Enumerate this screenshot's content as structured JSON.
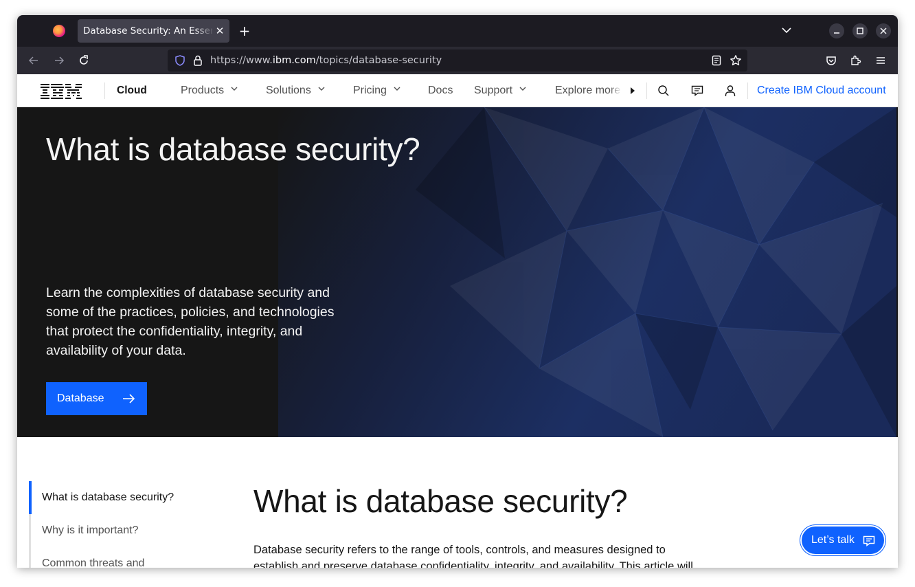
{
  "browser": {
    "tab_title": "Database Security: An Essential Guide",
    "url_prefix": "https://www.",
    "url_host": "ibm.com",
    "url_path": "/topics/database-security",
    "new_tab_symbol": "+",
    "close_tab_symbol": "✕"
  },
  "masthead": {
    "logo": "IBM",
    "product": "Cloud",
    "nav": [
      {
        "label": "Products",
        "has_menu": true
      },
      {
        "label": "Solutions",
        "has_menu": true
      },
      {
        "label": "Pricing",
        "has_menu": true
      },
      {
        "label": "Docs",
        "has_menu": false
      },
      {
        "label": "Support",
        "has_menu": true
      },
      {
        "label": "Explore more",
        "has_menu": false
      }
    ],
    "cta": "Create IBM Cloud account"
  },
  "hero": {
    "title": "What is database security?",
    "description": "Learn the complexities of database security and some of the practices, policies, and technologies that protect the confidentiality, integrity, and availability of your data.",
    "button_label": "Database"
  },
  "toc": {
    "items": [
      {
        "label": "What is database security?",
        "active": true
      },
      {
        "label": "Why is it important?",
        "active": false
      },
      {
        "label": "Common threats and",
        "active": false
      }
    ]
  },
  "article": {
    "title": "What is database security?",
    "body": "Database security refers to the range of tools, controls, and measures designed to establish and preserve database confidentiality, integrity, and availability. This article will"
  },
  "chat": {
    "label": "Let’s talk"
  },
  "colors": {
    "ibm_blue": "#0f62fe",
    "hero_bg": "#161616",
    "browser_chrome": "#1c1b22"
  }
}
